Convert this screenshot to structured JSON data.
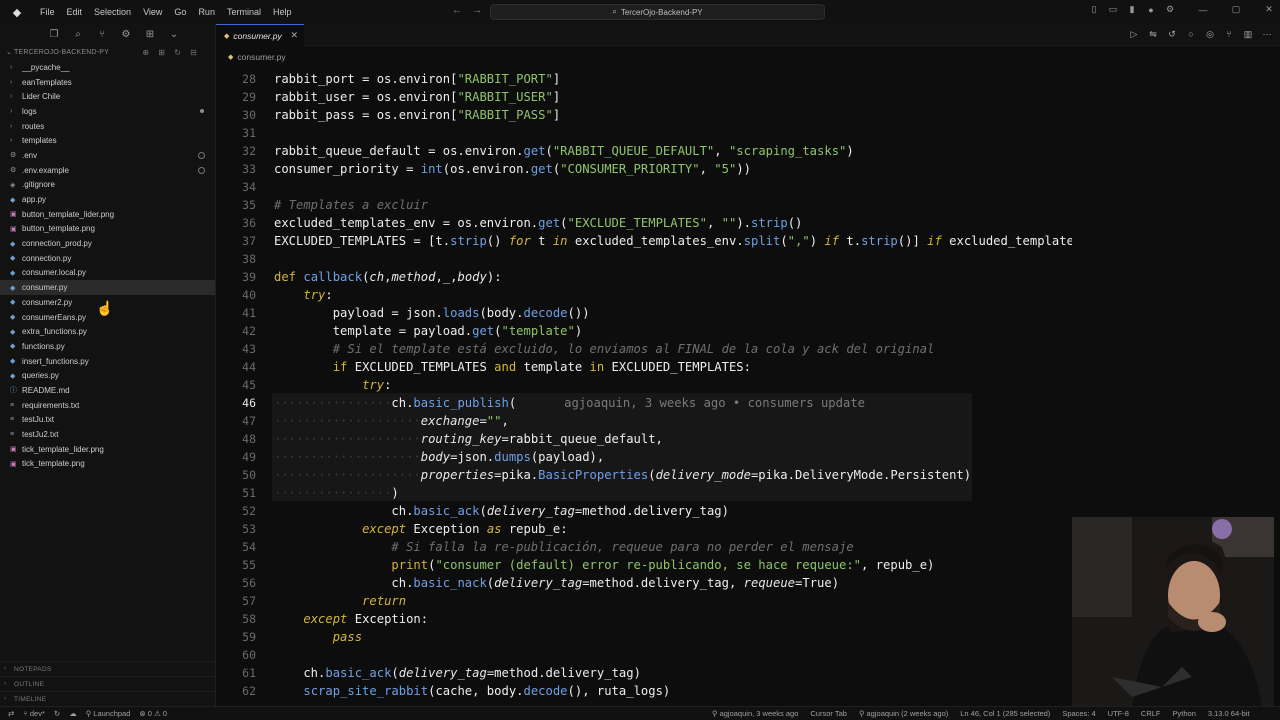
{
  "titlebar": {
    "menu": [
      "File",
      "Edit",
      "Selection",
      "View",
      "Go",
      "Run",
      "Terminal",
      "Help"
    ],
    "search_text": "TercerOjo-Backend-PY"
  },
  "explorer": {
    "project_name": "TERCEROJO-BACKEND-PY",
    "items": [
      {
        "label": "__pycache__",
        "type": "folder"
      },
      {
        "label": "eanTemplates",
        "type": "folder"
      },
      {
        "label": "Lider Chile",
        "type": "folder"
      },
      {
        "label": "logs",
        "type": "folder",
        "status": "dot"
      },
      {
        "label": "routes",
        "type": "folder"
      },
      {
        "label": "templates",
        "type": "folder"
      },
      {
        "label": ".env",
        "type": "env",
        "status": "ring"
      },
      {
        "label": ".env.example",
        "type": "env",
        "status": "ring"
      },
      {
        "label": ".gitignore",
        "type": "git"
      },
      {
        "label": "app.py",
        "type": "py"
      },
      {
        "label": "button_template_lider.png",
        "type": "img"
      },
      {
        "label": "button_template.png",
        "type": "img"
      },
      {
        "label": "connection_prod.py",
        "type": "py"
      },
      {
        "label": "connection.py",
        "type": "py"
      },
      {
        "label": "consumer.local.py",
        "type": "py"
      },
      {
        "label": "consumer.py",
        "type": "py",
        "selected": true
      },
      {
        "label": "consumer2.py",
        "type": "py"
      },
      {
        "label": "consumerEans.py",
        "type": "py"
      },
      {
        "label": "extra_functions.py",
        "type": "py"
      },
      {
        "label": "functions.py",
        "type": "py"
      },
      {
        "label": "insert_functions.py",
        "type": "py"
      },
      {
        "label": "queries.py",
        "type": "py"
      },
      {
        "label": "README.md",
        "type": "md"
      },
      {
        "label": "requirements.txt",
        "type": "txt"
      },
      {
        "label": "testJu.txt",
        "type": "txt"
      },
      {
        "label": "testJu2.txt",
        "type": "txt"
      },
      {
        "label": "tick_template_lider.png",
        "type": "img"
      },
      {
        "label": "tick_template.png",
        "type": "img"
      }
    ],
    "bottom_sections": [
      "NOTEPADS",
      "OUTLINE",
      "TIMELINE"
    ]
  },
  "editor": {
    "tab_label": "consumer.py",
    "breadcrumb": "consumer.py",
    "active_line": 46,
    "blame": "agjoaquin, 3 weeks ago • consumers update",
    "lines": [
      28,
      29,
      30,
      31,
      32,
      33,
      34,
      35,
      36,
      37,
      38,
      39,
      40,
      41,
      42,
      43,
      44,
      45,
      46,
      47,
      48,
      49,
      50,
      51,
      52,
      53,
      54,
      55,
      56,
      57,
      58,
      59,
      60,
      61,
      62
    ]
  },
  "statusbar": {
    "branch": "dev*",
    "launchpad": "Launchpad",
    "problems": "0",
    "warnings": "0",
    "blame": "agjoaquin, 3 weeks ago",
    "cursor_tab": "Cursor Tab",
    "blame2": "agjoaquin (2 weeks ago)",
    "position": "Ln 46, Col 1 (285 selected)",
    "spaces": "Spaces: 4",
    "encoding": "UTF-8",
    "eol": "CRLF",
    "language": "Python",
    "python": "3.13.0 64-bit"
  },
  "colors": {
    "keyword": "#d4b43d",
    "string": "#8fc46d",
    "function": "#6fa0e3",
    "comment": "#6f6f6f",
    "accent": "#3a6fd8"
  }
}
